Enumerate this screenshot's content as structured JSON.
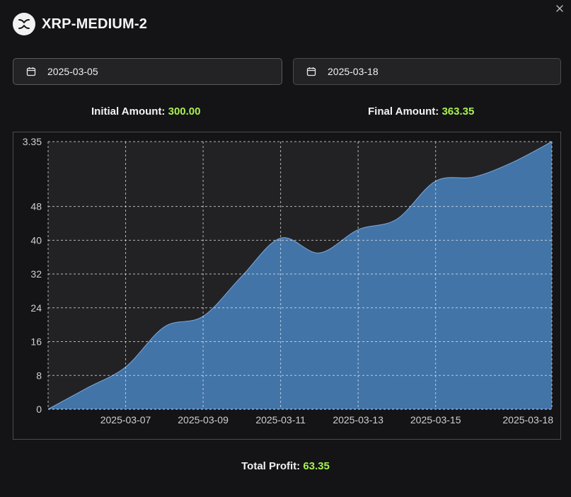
{
  "header": {
    "title": "XRP-MEDIUM-2",
    "logo_icon": "xrp-logo-icon",
    "close_icon": "close-icon"
  },
  "date_range": {
    "start": "2025-03-05",
    "end": "2025-03-18",
    "icon": "calendar-icon"
  },
  "summary": {
    "initial_label": "Initial Amount:",
    "initial_value": "300.00",
    "final_label": "Final Amount:",
    "final_value": "363.35",
    "total_label": "Total Profit:",
    "total_value": "63.35",
    "value_color": "#a8f050"
  },
  "chart_data": {
    "type": "area",
    "series": [
      {
        "x": [
          "2025-03-05",
          "2025-03-06",
          "2025-03-07",
          "2025-03-08",
          "2025-03-09",
          "2025-03-10",
          "2025-03-11",
          "2025-03-12",
          "2025-03-13",
          "2025-03-14",
          "2025-03-15",
          "2025-03-16",
          "2025-03-17",
          "2025-03-18"
        ],
        "values": [
          0,
          5,
          10,
          19.5,
          22,
          31.5,
          40.5,
          37,
          42.5,
          45,
          54,
          55,
          58.5,
          63.35
        ]
      }
    ],
    "x_tick_labels": [
      "2025-03-07",
      "2025-03-09",
      "2025-03-11",
      "2025-03-13",
      "2025-03-15",
      "2025-03-18"
    ],
    "y_tick_labels": [
      "0",
      "8",
      "16",
      "24",
      "32",
      "40",
      "48",
      "3.35"
    ],
    "y_tick_values": [
      0,
      8,
      16,
      24,
      32,
      40,
      48,
      63.35
    ],
    "ylim": [
      0,
      63.35
    ],
    "grid": true,
    "fill_color": "#4274a8",
    "line_color": "#7ea9d8"
  }
}
